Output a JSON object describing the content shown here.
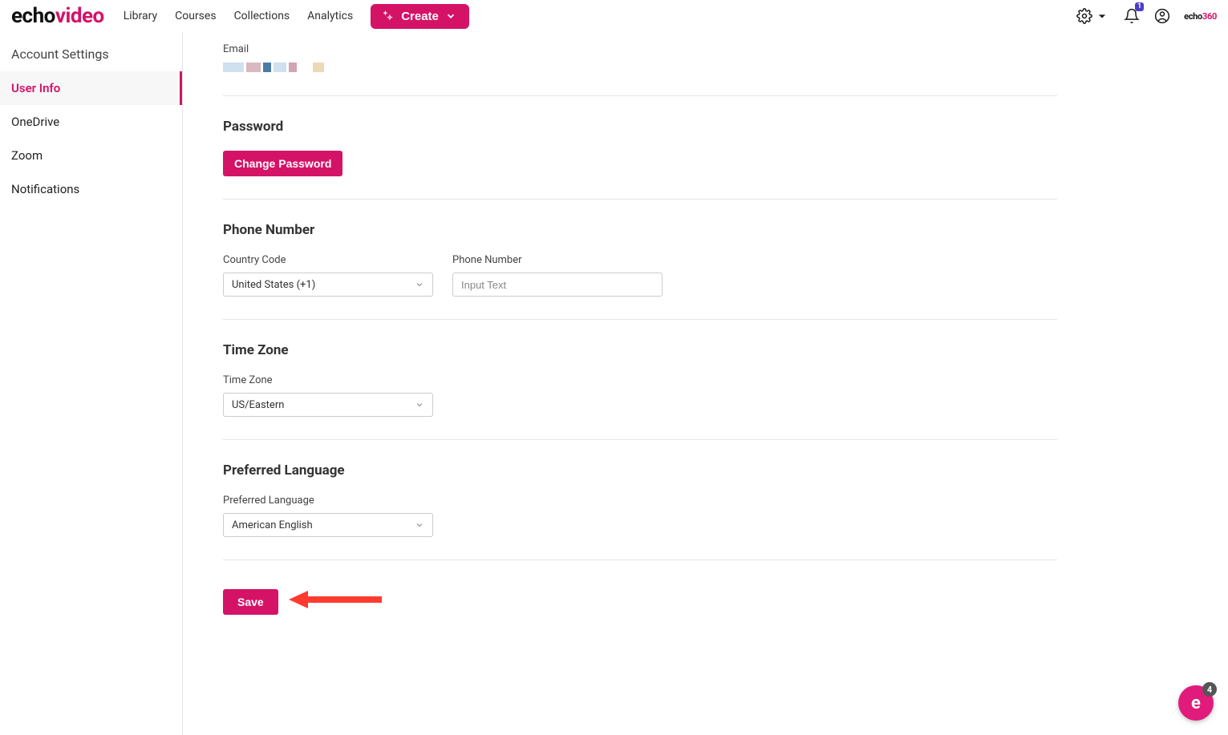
{
  "brand": {
    "part1": "echo",
    "part2": "video",
    "mini1": "echo",
    "mini2": "360"
  },
  "nav": {
    "library": "Library",
    "courses": "Courses",
    "collections": "Collections",
    "analytics": "Analytics",
    "create": "Create"
  },
  "notifications": {
    "badge": "1"
  },
  "sidebar": {
    "title": "Account Settings",
    "items": [
      {
        "label": "User Info"
      },
      {
        "label": "OneDrive"
      },
      {
        "label": "Zoom"
      },
      {
        "label": "Notifications"
      }
    ]
  },
  "sections": {
    "email": {
      "label": "Email"
    },
    "password": {
      "title": "Password",
      "button": "Change Password"
    },
    "phone": {
      "title": "Phone Number",
      "country_label": "Country Code",
      "country_value": "United States (+1)",
      "number_label": "Phone Number",
      "number_placeholder": "Input Text"
    },
    "timezone": {
      "title": "Time Zone",
      "label": "Time Zone",
      "value": "US/Eastern"
    },
    "language": {
      "title": "Preferred Language",
      "label": "Preferred Language",
      "value": "American English"
    },
    "save": "Save"
  },
  "help": {
    "badge": "4",
    "glyph": "e"
  }
}
